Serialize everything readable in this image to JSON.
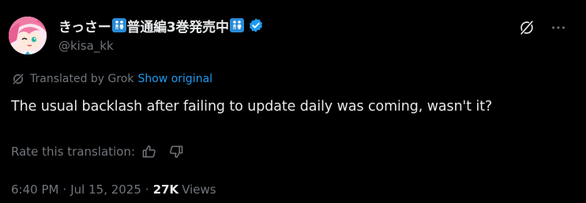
{
  "tweet": {
    "display_name_parts": [
      "きっさー",
      "普通編3巻発売中"
    ],
    "handle": "@kisa_kk",
    "translated_label": "Translated by Grok",
    "show_original": "Show original",
    "body": "The usual backlash after failing to update daily was coming, wasn't it?",
    "rate_label": "Rate this translation:",
    "time": "6:40 PM",
    "date": "Jul 15, 2025",
    "separator": "·",
    "views_count": "27K",
    "views_label": "Views"
  },
  "icons": {
    "avatar": "avatar-anime-girl",
    "emoji": "couple-emoji",
    "verified": "verified-badge-icon",
    "grok": "grok-icon",
    "more": "more-icon",
    "translated": "grok-translate-icon",
    "thumbs_up": "thumbs-up-icon",
    "thumbs_down": "thumbs-down-icon"
  },
  "colors": {
    "background": "#000000",
    "primary_text": "#e7e9ea",
    "secondary_text": "#71767b",
    "link": "#1d9bf0",
    "verified": "#1d9bf0",
    "emoji_tile": "#2a8bd6"
  }
}
